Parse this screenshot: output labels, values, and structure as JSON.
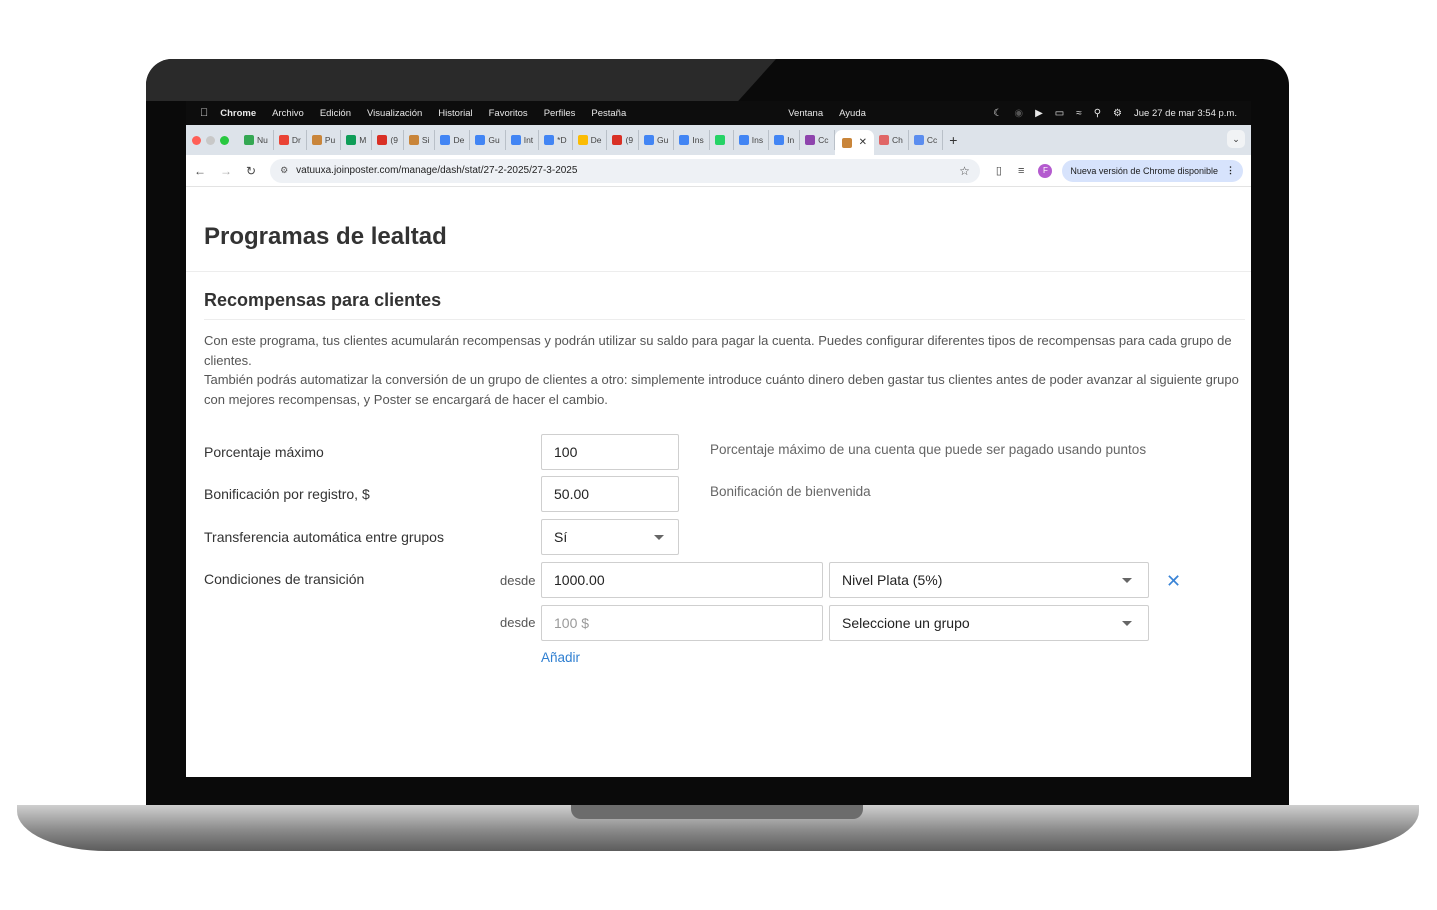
{
  "menubar": {
    "app": "Chrome",
    "items": [
      "Archivo",
      "Edición",
      "Visualización",
      "Historial",
      "Favoritos",
      "Perfiles",
      "Pestaña"
    ],
    "right_items": [
      "Ventana",
      "Ayuda"
    ],
    "clock": "Jue 27 de mar  3:54 p.m."
  },
  "tabs": [
    {
      "label": "Nu",
      "color": "#34a853"
    },
    {
      "label": "Dr",
      "color": "#ea4335"
    },
    {
      "label": "Pu",
      "color": "#c9853a"
    },
    {
      "label": "M",
      "color": "#0f9d58"
    },
    {
      "label": "(9",
      "color": "#d93025"
    },
    {
      "label": "Si",
      "color": "#c9853a"
    },
    {
      "label": "De",
      "color": "#4285f4"
    },
    {
      "label": "Gu",
      "color": "#4285f4"
    },
    {
      "label": "Int",
      "color": "#4285f4"
    },
    {
      "label": "*D",
      "color": "#4285f4"
    },
    {
      "label": "De",
      "color": "#fbbc04"
    },
    {
      "label": "(9",
      "color": "#d93025"
    },
    {
      "label": "Gu",
      "color": "#4285f4"
    },
    {
      "label": "Ins",
      "color": "#4285f4"
    },
    {
      "label": "",
      "color": "#25d366"
    },
    {
      "label": "Ins",
      "color": "#4285f4"
    },
    {
      "label": "In",
      "color": "#4285f4"
    },
    {
      "label": "Cc",
      "color": "#8e44ad"
    }
  ],
  "tabs_after": [
    {
      "label": "Ch",
      "color": "#e06666"
    },
    {
      "label": "Cc",
      "color": "#5b8def"
    }
  ],
  "address": {
    "url": "vatuuxa.joinposter.com/manage/dash/stat/27-2-2025/27-3-2025",
    "profile_initial": "F",
    "update_label": "Nueva versión de Chrome disponible"
  },
  "page": {
    "title": "Programas de lealtad",
    "section_title": "Recompensas para clientes",
    "description_1": "Con este programa, tus clientes acumularán recompensas y podrán utilizar su saldo para pagar la cuenta. Puedes configurar diferentes tipos de recompensas para cada grupo de clientes.",
    "description_2": "También podrás automatizar la conversión de un grupo de clientes a otro: simplemente introduce cuánto dinero deben gastar tus clientes antes de poder avanzar al siguiente grupo con mejores recompensas, y Poster se encargará de hacer el cambio."
  },
  "form": {
    "max_percent_label": "Porcentaje máximo",
    "max_percent_value": "100",
    "max_percent_hint": "Porcentaje máximo de una cuenta que puede ser pagado usando puntos",
    "signup_bonus_label": "Bonificación por registro, $",
    "signup_bonus_value": "50.00",
    "signup_bonus_hint": "Bonificación de bienvenida",
    "auto_transfer_label": "Transferencia automática entre grupos",
    "auto_transfer_value": "Sí",
    "conditions_label": "Condiciones de transición",
    "rows": [
      {
        "from_label": "desde",
        "amount": "1000.00",
        "group": "Nivel Plata (5%)"
      },
      {
        "from_label": "desde",
        "amount_placeholder": "100 $",
        "group": "Seleccione un grupo"
      }
    ],
    "add_label": "Añadir"
  }
}
